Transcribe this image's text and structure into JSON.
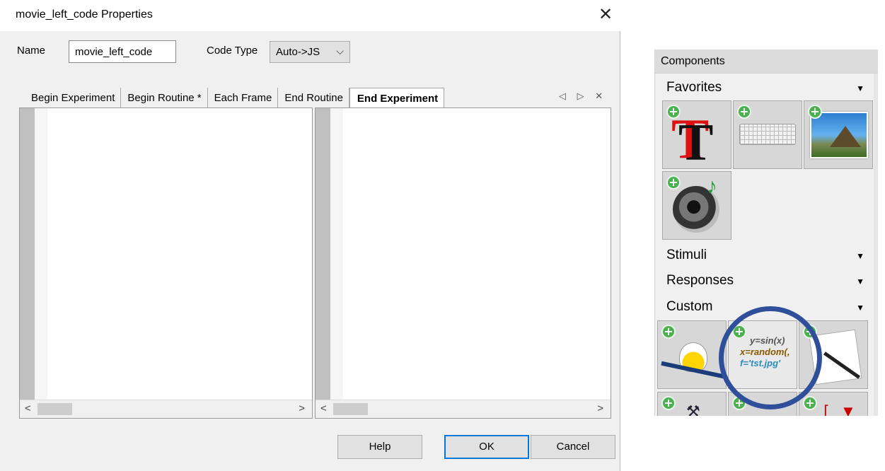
{
  "dialog": {
    "title": "movie_left_code Properties",
    "close_label": "✕",
    "name_label": "Name",
    "name_value": "movie_left_code",
    "code_type_label": "Code Type",
    "code_type_value": "Auto->JS",
    "tabs": [
      {
        "label": "Begin Experiment",
        "active": false
      },
      {
        "label": "Begin Routine *",
        "active": false
      },
      {
        "label": "Each Frame",
        "active": false
      },
      {
        "label": "End Routine",
        "active": false
      },
      {
        "label": "End Experiment",
        "active": true
      }
    ],
    "tab_controls": {
      "prev": "◁",
      "next": "▷",
      "close": "✕"
    },
    "scroll_left": "<",
    "scroll_right": ">",
    "buttons": {
      "help": "Help",
      "ok": "OK",
      "cancel": "Cancel"
    }
  },
  "components": {
    "header": "Components",
    "categories": {
      "favorites": "Favorites",
      "stimuli": "Stimuli",
      "responses": "Responses",
      "custom": "Custom"
    },
    "expand_glyph": "▼",
    "plus_glyph": "+",
    "text_icon_letter": "T",
    "code_icon_lines": [
      "y=sin(x)",
      "x=random(,",
      "f='tst.jpg'"
    ]
  },
  "colors": {
    "ok_border": "#0078d7",
    "highlight_circle": "#2f4f9a",
    "plus_green": "#4caf50"
  }
}
